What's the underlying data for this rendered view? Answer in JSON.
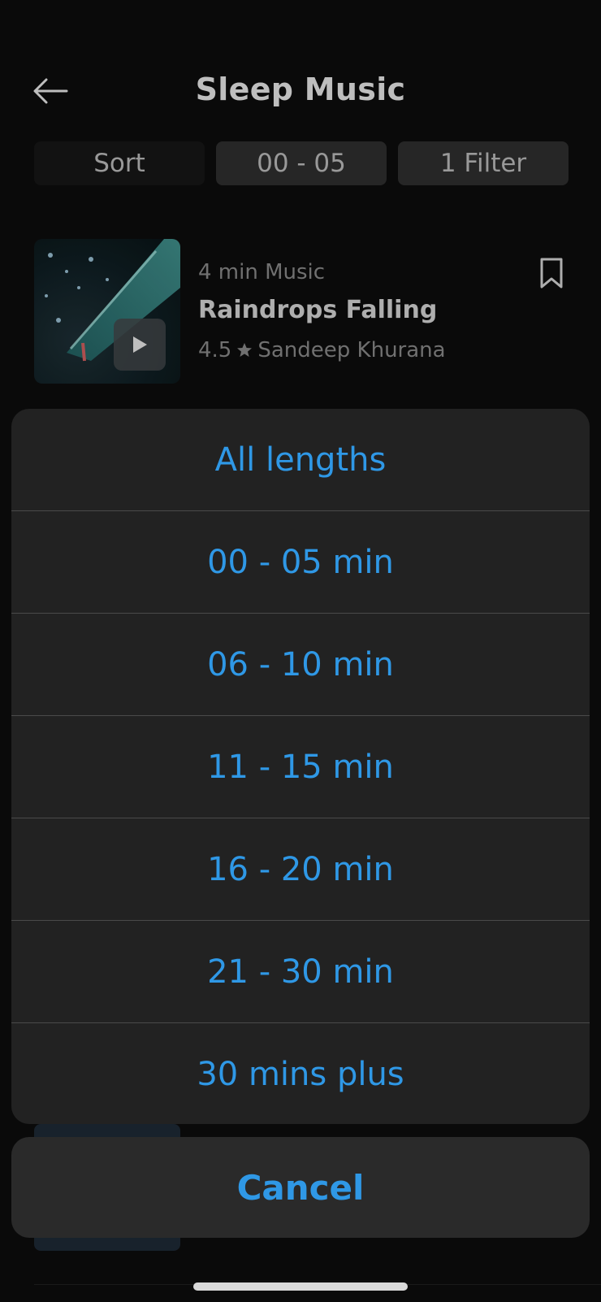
{
  "header": {
    "title": "Sleep Music",
    "back_icon": "arrow-left-icon"
  },
  "chips": {
    "sort": "Sort",
    "length": "00 - 05",
    "filter": "1 Filter"
  },
  "item": {
    "meta": "4 min Music",
    "title": "Raindrops Falling",
    "rating": "4.5",
    "author": "Sandeep Khurana",
    "star_icon": "star-icon",
    "bookmark_icon": "bookmark-icon",
    "play_icon": "play-icon"
  },
  "sheet": {
    "options": [
      "All lengths",
      "00 - 05 min",
      "06 - 10 min",
      "11 - 15 min",
      "16 - 20 min",
      "21 - 30 min",
      "30 mins plus"
    ],
    "cancel": "Cancel"
  },
  "colors": {
    "accent": "#2f98e6",
    "background": "#0b0b0b",
    "sheet": "#222222"
  }
}
